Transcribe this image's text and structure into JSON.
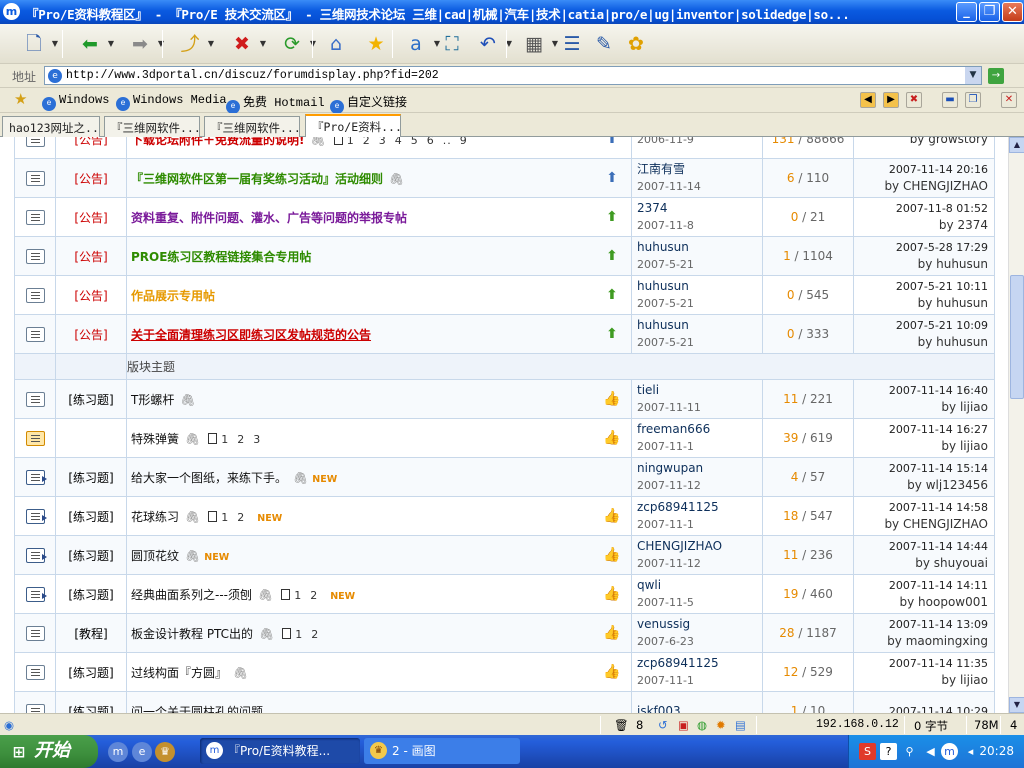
{
  "window": {
    "title": "『Pro/E资料教程区』 - 『Pro/E 技术交流区』 - 三维网技术论坛 三维|cad|机械|汽车|技术|catia|pro/e|ug|inventor|solidedge|so...",
    "minimize": "_",
    "restore": "❐",
    "close": "✕",
    "app_icon": "m"
  },
  "toolbar": {
    "buttons": [
      {
        "name": "new-page",
        "glyph": "🗋",
        "color": "#2b5aa8"
      },
      {
        "name": "back",
        "glyph": "⬅",
        "color": "#1f9a2a"
      },
      {
        "name": "forward",
        "glyph": "➡",
        "color": "#8a8a8a"
      },
      {
        "name": "up",
        "glyph": "⤴",
        "color": "#d4a017"
      },
      {
        "name": "stop",
        "glyph": "✖",
        "color": "#d01c1c"
      },
      {
        "name": "refresh",
        "glyph": "⟳",
        "color": "#2a9a2a"
      },
      {
        "name": "home",
        "glyph": "⌂",
        "color": "#3a6ec8"
      },
      {
        "name": "favorites",
        "glyph": "★",
        "color": "#f2b300"
      },
      {
        "name": "translate",
        "glyph": "a",
        "color": "#2a6ec8"
      },
      {
        "name": "zoom",
        "glyph": "⛶",
        "color": "#1f6e9a"
      },
      {
        "name": "undo",
        "glyph": "↶",
        "color": "#1f4fb8"
      },
      {
        "name": "tools",
        "glyph": "▦",
        "color": "#555555"
      },
      {
        "name": "list",
        "glyph": "☰",
        "color": "#2a5aa8"
      },
      {
        "name": "edit",
        "glyph": "✎",
        "color": "#2a5aa8"
      },
      {
        "name": "plugin",
        "glyph": "✿",
        "color": "#e0a000"
      }
    ]
  },
  "address": {
    "label": "地址",
    "url": "http://www.3dportal.cn/discuz/forumdisplay.php?fid=202",
    "icon": "e",
    "go": "→"
  },
  "links": [
    {
      "label": "Windows"
    },
    {
      "label": "Windows Media"
    },
    {
      "label": "免费 Hotmail"
    },
    {
      "label": "自定义链接"
    }
  ],
  "tabs": [
    {
      "label": "hao123网址之..."
    },
    {
      "label": "『三维网软件..."
    },
    {
      "label": "『三维网软件..."
    },
    {
      "label": "『Pro/E资料..."
    }
  ],
  "threads": [
    {
      "icon": "normal",
      "tag": "[公告]",
      "tag_color": "red",
      "subject": "下载论坛附件＋免费流量的说明!",
      "style": "red",
      "clip": true,
      "pages": [
        "1",
        "2",
        "3",
        "4",
        "5",
        "6",
        "..",
        "9"
      ],
      "new": "",
      "status": "pin",
      "author": "",
      "date": "2006-11-9",
      "replies": "131",
      "views": "88666",
      "last_time": "",
      "last_by": "by growstory"
    },
    {
      "icon": "normal",
      "tag": "[公告]",
      "tag_color": "red",
      "subject": "『三维网软件区第一届有奖练习活动』活动细则",
      "style": "green",
      "clip": true,
      "pages": [],
      "new": "",
      "status": "pin",
      "author": "江南有雪",
      "date": "2007-11-14",
      "replies": "6",
      "views": "110",
      "last_time": "2007-11-14 20:16",
      "last_by": "by CHENGJIZHAO"
    },
    {
      "icon": "normal",
      "tag": "[公告]",
      "tag_color": "red",
      "subject": "资料重复、附件问题、灌水、广告等问题的举报专帖",
      "style": "purple",
      "clip": false,
      "pages": [],
      "new": "",
      "status": "up",
      "author": "2374",
      "date": "2007-11-8",
      "replies": "0",
      "views": "21",
      "last_time": "2007-11-8 01:52",
      "last_by": "by 2374"
    },
    {
      "icon": "normal",
      "tag": "[公告]",
      "tag_color": "red",
      "subject": "PROE练习区教程链接集合专用帖",
      "style": "green",
      "clip": false,
      "pages": [],
      "new": "",
      "status": "up",
      "author": "huhusun",
      "date": "2007-5-21",
      "replies": "1",
      "views": "1104",
      "last_time": "2007-5-28 17:29",
      "last_by": "by huhusun"
    },
    {
      "icon": "normal",
      "tag": "[公告]",
      "tag_color": "red",
      "subject": "作品展示专用帖",
      "style": "orange",
      "clip": false,
      "pages": [],
      "new": "",
      "status": "up",
      "author": "huhusun",
      "date": "2007-5-21",
      "replies": "0",
      "views": "545",
      "last_time": "2007-5-21 10:11",
      "last_by": "by huhusun"
    },
    {
      "icon": "normal",
      "tag": "[公告]",
      "tag_color": "red",
      "subject": "关于全面清理练习区即练习区发帖规范的公告",
      "style": "redline",
      "clip": false,
      "pages": [],
      "new": "",
      "status": "up",
      "author": "huhusun",
      "date": "2007-5-21",
      "replies": "0",
      "views": "333",
      "last_time": "2007-5-21 10:09",
      "last_by": "by huhusun"
    },
    {
      "section": "版块主题"
    },
    {
      "icon": "normal",
      "tag": "[练习题]",
      "tag_color": "black",
      "subject": "T形螺杆",
      "style": "normal",
      "clip": true,
      "pages": [],
      "new": "",
      "status": "hand",
      "author": "tieli",
      "date": "2007-11-11",
      "replies": "11",
      "views": "221",
      "last_time": "2007-11-14 16:40",
      "last_by": "by lijiao"
    },
    {
      "icon": "hot",
      "tag": "",
      "tag_color": "black",
      "subject": "特殊弹簧",
      "style": "normal",
      "clip": true,
      "pages": [
        "1",
        "2",
        "3"
      ],
      "new": "",
      "status": "hand",
      "author": "freeman666",
      "date": "2007-11-1",
      "replies": "39",
      "views": "619",
      "last_time": "2007-11-14 16:27",
      "last_by": "by lijiao"
    },
    {
      "icon": "new",
      "tag": "[练习题]",
      "tag_color": "black",
      "subject": "给大家一个图纸，来练下手。",
      "style": "normal",
      "clip": true,
      "pages": [],
      "new": "NEW",
      "status": "",
      "author": "ningwupan",
      "date": "2007-11-12",
      "replies": "4",
      "views": "57",
      "last_time": "2007-11-14 15:14",
      "last_by": "by wlj123456"
    },
    {
      "icon": "new",
      "tag": "[练习题]",
      "tag_color": "black",
      "subject": "花球练习",
      "style": "normal",
      "clip": true,
      "pages": [
        "1",
        "2"
      ],
      "new": "NEW",
      "status": "hand",
      "author": "zcp68941125",
      "date": "2007-11-1",
      "replies": "18",
      "views": "547",
      "last_time": "2007-11-14 14:58",
      "last_by": "by CHENGJIZHAO"
    },
    {
      "icon": "new",
      "tag": "[练习题]",
      "tag_color": "black",
      "subject": "圆顶花纹",
      "style": "normal",
      "clip": true,
      "pages": [],
      "new": "NEW",
      "status": "hand",
      "author": "CHENGJIZHAO",
      "date": "2007-11-12",
      "replies": "11",
      "views": "236",
      "last_time": "2007-11-14 14:44",
      "last_by": "by shuyouai"
    },
    {
      "icon": "new",
      "tag": "[练习题]",
      "tag_color": "black",
      "subject": "经典曲面系列之---须刨",
      "style": "normal",
      "clip": true,
      "pages": [
        "1",
        "2"
      ],
      "new": "NEW",
      "status": "hand",
      "author": "qwli",
      "date": "2007-11-5",
      "replies": "19",
      "views": "460",
      "last_time": "2007-11-14 14:11",
      "last_by": "by hoopow001"
    },
    {
      "icon": "normal",
      "tag": "[教程]",
      "tag_color": "black",
      "subject": "板金设计教程 PTC出的",
      "style": "normal",
      "clip": true,
      "pages": [
        "1",
        "2"
      ],
      "new": "",
      "status": "hand",
      "author": "venussig",
      "date": "2007-6-23",
      "replies": "28",
      "views": "1187",
      "last_time": "2007-11-14 13:09",
      "last_by": "by maomingxing"
    },
    {
      "icon": "normal",
      "tag": "[练习题]",
      "tag_color": "black",
      "subject": "过线构面『方圆』",
      "style": "normal",
      "clip": true,
      "pages": [],
      "new": "",
      "status": "hand",
      "author": "zcp68941125",
      "date": "2007-11-1",
      "replies": "12",
      "views": "529",
      "last_time": "2007-11-14 11:35",
      "last_by": "by lijiao"
    },
    {
      "icon": "normal",
      "tag": "[练习题]",
      "tag_color": "black",
      "subject": "问一个关于圆柱孔的问题",
      "style": "normal",
      "clip": false,
      "pages": [],
      "new": "",
      "status": "",
      "author": "jskf003",
      "date": "",
      "replies": "1",
      "views": "10",
      "last_time": "2007-11-14 10:29",
      "last_by": ""
    }
  ],
  "status": {
    "zoom_count": "8",
    "ip": "192.168.0.12",
    "bytes": "0 字节",
    "mem": "78M",
    "num": "4"
  },
  "taskbar": {
    "start": "开始",
    "tasks": [
      {
        "label": "『Pro/E资料教程...",
        "active": true
      },
      {
        "label": "2 - 画图",
        "active": false
      }
    ],
    "clock": "20:28"
  }
}
